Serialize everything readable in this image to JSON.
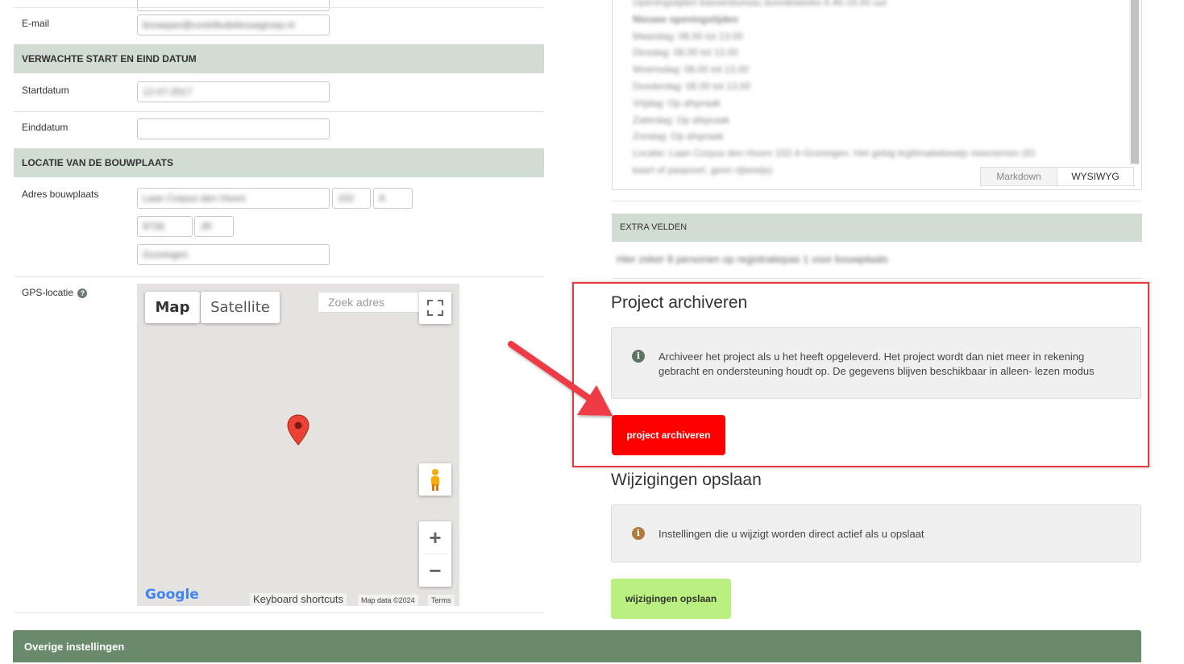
{
  "form": {
    "email_label": "E-mail",
    "email_value": "bouwpan@contributiebouwgroep.nl",
    "section_dates": "VERWACHTE START EN EIND DATUM",
    "start_label": "Startdatum",
    "start_value": "12-07-2017",
    "end_label": "Einddatum",
    "end_value": "",
    "section_location": "LOCATIE VAN DE BOUWPLAATS",
    "address_label": "Adres bouwplaats",
    "street_value": "Laan Corpus den Hoorn",
    "number_value": "102",
    "addition_value": "A",
    "postcode_value": "9728",
    "postcode_suffix_value": "JR",
    "city_value": "Groningen",
    "gps_label": "GPS-locatie",
    "gps_help": "?"
  },
  "map": {
    "tab_map": "Map",
    "tab_satellite": "Satellite",
    "search_placeholder": "Zoek adres",
    "zoom_in": "+",
    "zoom_out": "−",
    "google": "Google",
    "keyboard_shortcuts": "Keyboard shortcuts",
    "map_data": "Map data ©2024",
    "terms": "Terms"
  },
  "description": {
    "lines": [
      "Openingstijden bassenbureau doordeweeks 6.45-16.00 uur",
      "Nieuwe openingstijden",
      "Maandag: 08.00 tot 13.00",
      "Dinsdag: 08.00 tot 13.00",
      "Woensdag: 08.00 tot 13.00",
      "Donderdag: 08.00 tot 13.00",
      "Vrijdag: Op afspraak",
      "Zaterdag: Op afspraak",
      "Zondag: Op afspraak",
      "Locatie: Laan Corpus den Hoorn 102-A Groningen. Het gebig legitimatiebewijs meenemen (ID",
      "kaart of paspoort, geen rijbewijs)"
    ],
    "tab_markdown": "Markdown",
    "tab_wysiwyg": "WYSIWYG"
  },
  "extra": {
    "heading": "EXTRA VELDEN",
    "value": "Hier zeker 8 personen op registratiepas 1 voor bouwplaats"
  },
  "archive": {
    "title": "Project archiveren",
    "info": "Archiveer het project als u het heeft opgeleverd. Het project wordt dan niet meer in rekening gebracht en ondersteuning houdt op. De gegevens blijven beschikbaar in alleen- lezen modus",
    "button": "project archiveren",
    "accent": "#ff0000"
  },
  "save": {
    "title": "Wijzigingen opslaan",
    "info": "Instellingen die u wijzigt worden direct actief als u opslaat",
    "button": "wijzigingen opslaan",
    "accent": "#b9f080"
  },
  "footer": {
    "section": "Overige instellingen"
  },
  "colors": {
    "section_bg": "#d1dcd3",
    "footer_bg": "#6a8a6c",
    "highlight": "#e8383d"
  }
}
